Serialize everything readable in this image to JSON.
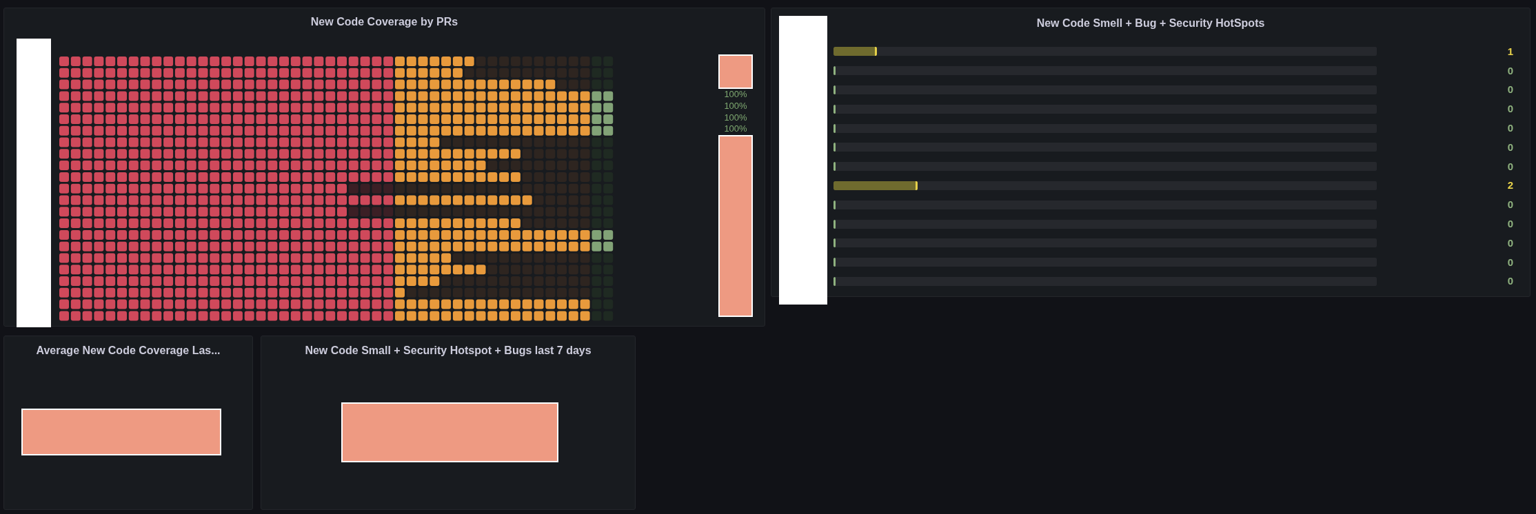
{
  "panels": [
    {
      "kind": "waffle",
      "title": "New Code Coverage by PRs",
      "labels": [
        "100%",
        "100%",
        "100%",
        "100%"
      ]
    },
    {
      "kind": "bargauge",
      "title": "New Code Smell + Bug + Security HotSpots",
      "rows": [
        {
          "value": "1",
          "level": 0.08,
          "color": "#e5d04a"
        },
        {
          "value": "0",
          "level": 0,
          "color": "#8fb27f"
        },
        {
          "value": "0",
          "level": 0,
          "color": "#8fb27f"
        },
        {
          "value": "0",
          "level": 0,
          "color": "#8fb27f"
        },
        {
          "value": "0",
          "level": 0,
          "color": "#8fb27f"
        },
        {
          "value": "0",
          "level": 0,
          "color": "#8fb27f"
        },
        {
          "value": "0",
          "level": 0,
          "color": "#8fb27f"
        },
        {
          "value": "2",
          "level": 0.155,
          "color": "#e5d04a"
        },
        {
          "value": "0",
          "level": 0,
          "color": "#8fb27f"
        },
        {
          "value": "0",
          "level": 0,
          "color": "#8fb27f"
        },
        {
          "value": "0",
          "level": 0,
          "color": "#8fb27f"
        },
        {
          "value": "0",
          "level": 0,
          "color": "#8fb27f"
        },
        {
          "value": "0",
          "level": 0,
          "color": "#8fb27f"
        }
      ]
    },
    {
      "kind": "stat",
      "title": "Average New Code Coverage Las..."
    },
    {
      "kind": "stat",
      "title": "New Code Small + Security Hotspot + Bugs last 7 days"
    }
  ]
}
